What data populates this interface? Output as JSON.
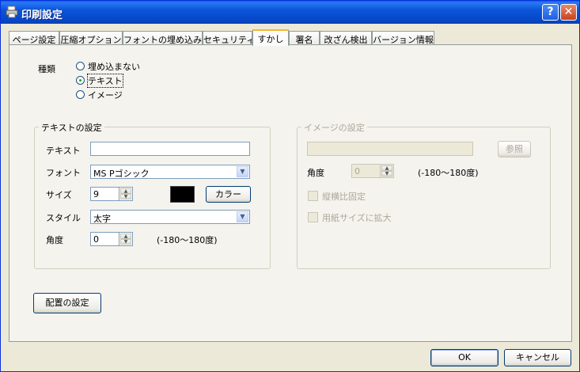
{
  "window": {
    "title": "印刷設定"
  },
  "tabs": [
    {
      "label": "ページ設定"
    },
    {
      "label": "圧縮オプション"
    },
    {
      "label": "フォントの埋め込み"
    },
    {
      "label": "セキュリティ"
    },
    {
      "label": "すかし"
    },
    {
      "label": "署名"
    },
    {
      "label": "改ざん検出"
    },
    {
      "label": "バージョン情報"
    }
  ],
  "active_tab": "すかし",
  "type_section": {
    "label": "種類",
    "options": [
      "埋め込まない",
      "テキスト",
      "イメージ"
    ],
    "selected": "テキスト"
  },
  "text_settings": {
    "group_title": "テキストの設定",
    "text_label": "テキスト",
    "text_value": "",
    "font_label": "フォント",
    "font_value": "MS Pゴシック",
    "size_label": "サイズ",
    "size_value": "9",
    "color_button": "カラー",
    "color_value": "#000000",
    "style_label": "スタイル",
    "style_value": "太字",
    "angle_label": "角度",
    "angle_value": "0",
    "angle_range": "(-180～180度)"
  },
  "image_settings": {
    "group_title": "イメージの設定",
    "path_value": "",
    "browse_button": "参照",
    "angle_label": "角度",
    "angle_value": "0",
    "angle_range": "(-180～180度)",
    "keep_ratio_label": "縦横比固定",
    "fit_paper_label": "用紙サイズに拡大"
  },
  "placement_button": "配置の設定",
  "footer": {
    "ok": "OK",
    "cancel": "キャンセル"
  },
  "colors": {
    "title_bar": "#0a55d8",
    "dialog_bg": "#ece9d8",
    "panel_bg": "#f4f3ee",
    "active_tab_accent": "#f8b433"
  }
}
